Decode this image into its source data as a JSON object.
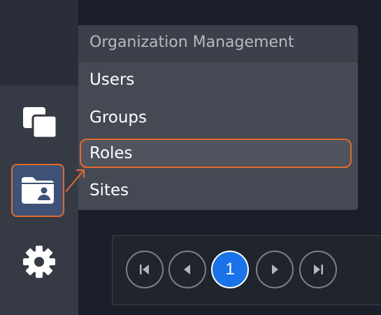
{
  "sidebar": {
    "items": [
      {
        "icon": "copy-icon"
      },
      {
        "icon": "folder-user-icon",
        "active": true
      },
      {
        "icon": "gear-icon"
      }
    ]
  },
  "menu": {
    "header": "Organization Management",
    "items": [
      {
        "label": "Users"
      },
      {
        "label": "Groups"
      },
      {
        "label": "Roles",
        "highlighted": true
      },
      {
        "label": "Sites"
      }
    ]
  },
  "pagination": {
    "current_page": "1",
    "buttons": [
      "first-page-icon",
      "previous-page-icon",
      "next-page-icon",
      "last-page-icon"
    ]
  },
  "colors": {
    "accent": "#e26a2c",
    "primary": "#1a73e8",
    "active_bg": "#3e5177"
  }
}
